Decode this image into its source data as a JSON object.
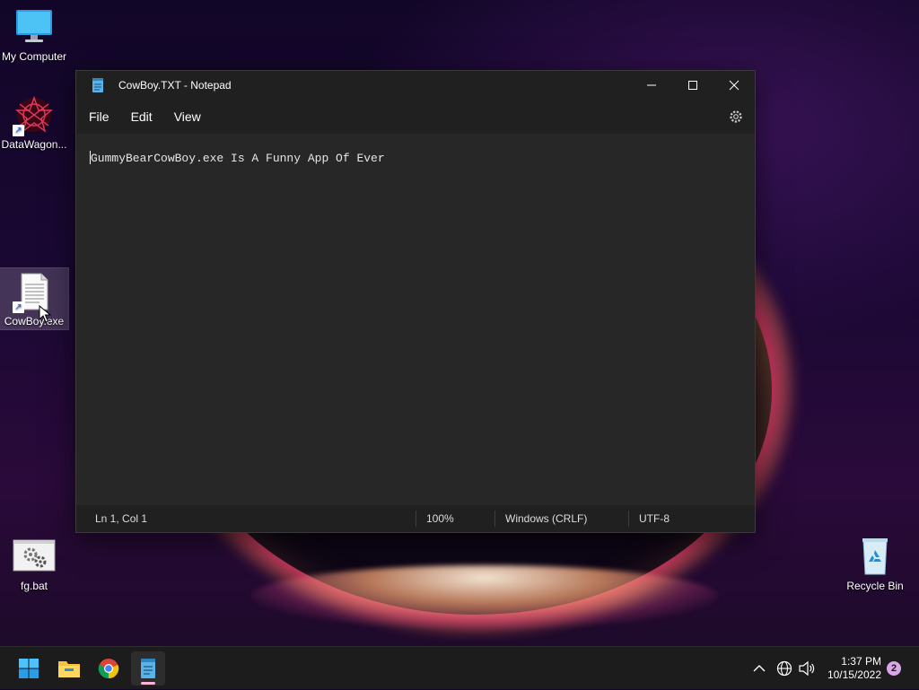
{
  "desktop": {
    "icons": [
      {
        "label": "My Computer"
      },
      {
        "label": "DataWagon..."
      },
      {
        "label": "CowBoy.exe"
      },
      {
        "label": "fg.bat"
      },
      {
        "label": "Recycle Bin"
      }
    ]
  },
  "notepad": {
    "title": "CowBoy.TXT - Notepad",
    "menu": [
      "File",
      "Edit",
      "View"
    ],
    "content": "GummyBearCowBoy.exe Is A Funny App Of Ever",
    "status": {
      "position": "Ln 1, Col 1",
      "zoom": "100%",
      "line_ending": "Windows (CRLF)",
      "encoding": "UTF-8"
    }
  },
  "taskbar": {
    "time": "1:37 PM",
    "date": "10/15/2022",
    "notifications": "2"
  },
  "colors": {
    "accent": "#0078d4",
    "notepad_bg": "#272727",
    "taskbar_bg": "#1c1c1c"
  }
}
